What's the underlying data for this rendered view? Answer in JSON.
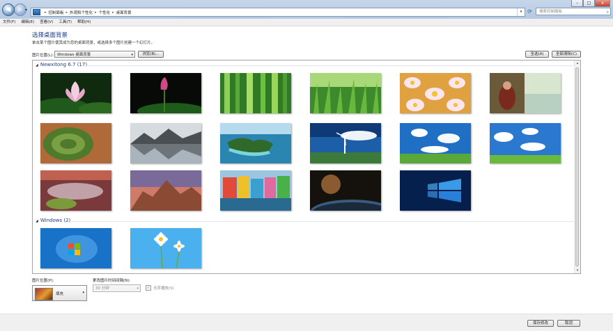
{
  "address": {
    "segments": [
      "控制面板",
      "外观和个性化",
      "个性化",
      "桌面背景"
    ],
    "search_placeholder": "搜索控制面板"
  },
  "window_buttons": {
    "minimize": "–",
    "maximize": "□",
    "close": "x"
  },
  "menu": [
    "文件(F)",
    "编辑(E)",
    "查看(V)",
    "工具(T)",
    "帮助(H)"
  ],
  "page": {
    "title": "选择桌面背景",
    "subtitle": "单击某个图片使其成为您的桌面背景，或选择多个图片创建一个幻灯片。"
  },
  "location": {
    "label": "图片位置(L):",
    "value": "Windows 桌面背景",
    "browse": "浏览(B)..."
  },
  "select_all": "全选(A)",
  "clear_all": "全部清除(C)",
  "groups": [
    {
      "name": "Newxitong 6.7 (17)",
      "count": 17
    },
    {
      "name": "Windows (2)",
      "count": 2
    }
  ],
  "position": {
    "label": "图片位置(P):",
    "value": "填充"
  },
  "interval": {
    "label": "更改图片时间间隔(N):",
    "value": "30 分钟"
  },
  "shuffle": {
    "label": "无序播放(S)"
  },
  "save": "保存修改",
  "cancel": "取消",
  "colors": {
    "accent": "#1e3d8a",
    "link": "#1e3d8a"
  }
}
